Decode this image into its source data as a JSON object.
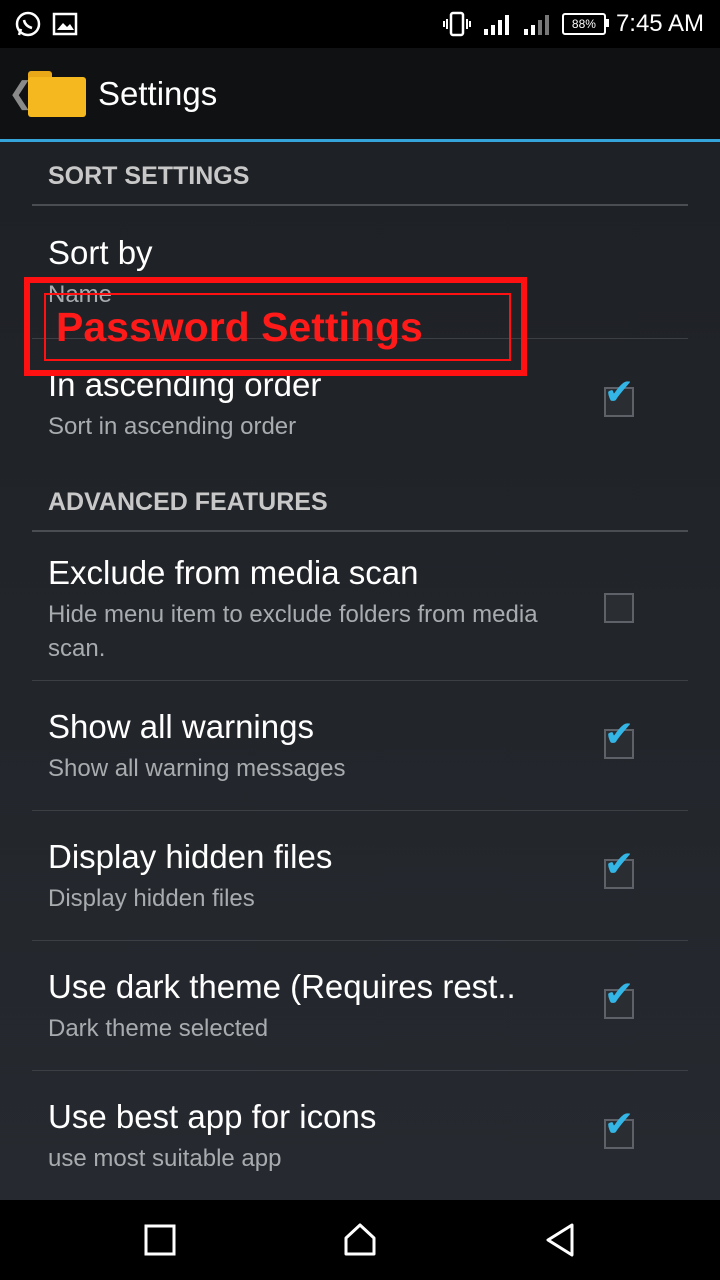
{
  "status_bar": {
    "time": "7:45 AM",
    "battery": "88%",
    "icons": [
      "whatsapp-icon",
      "image-icon",
      "vibrate-icon",
      "signal-icon",
      "signal-icon"
    ]
  },
  "action_bar": {
    "back_chevron": "❮",
    "title": "Settings"
  },
  "annotation": {
    "label": "Password Settings",
    "color": "#ff1111"
  },
  "sections": [
    {
      "header": "SORT SETTINGS",
      "items": [
        {
          "title": "Sort by",
          "summary": "Name"
        },
        {
          "title": "In ascending order",
          "summary": "Sort in ascending order",
          "checked": true
        }
      ]
    },
    {
      "header": "ADVANCED FEATURES",
      "items": [
        {
          "title": "Exclude from media scan",
          "summary": "Hide menu item to exclude folders from media scan.",
          "checked": false
        },
        {
          "title": "Show all warnings",
          "summary": "Show all warning messages",
          "checked": true
        },
        {
          "title": "Display hidden files",
          "summary": "Display hidden files",
          "checked": true
        },
        {
          "title": "Use dark theme (Requires rest..",
          "summary": "Dark theme selected",
          "checked": true
        },
        {
          "title": "Use best app for icons",
          "summary": "use most suitable app",
          "checked": true
        }
      ]
    }
  ],
  "checkmark": "✔",
  "colors": {
    "accent": "#33b5e5",
    "action_bar_line": "#35a4d8",
    "annotation": "#ff1111"
  },
  "nav_bar": [
    "recents-icon",
    "home-icon",
    "back-icon"
  ]
}
